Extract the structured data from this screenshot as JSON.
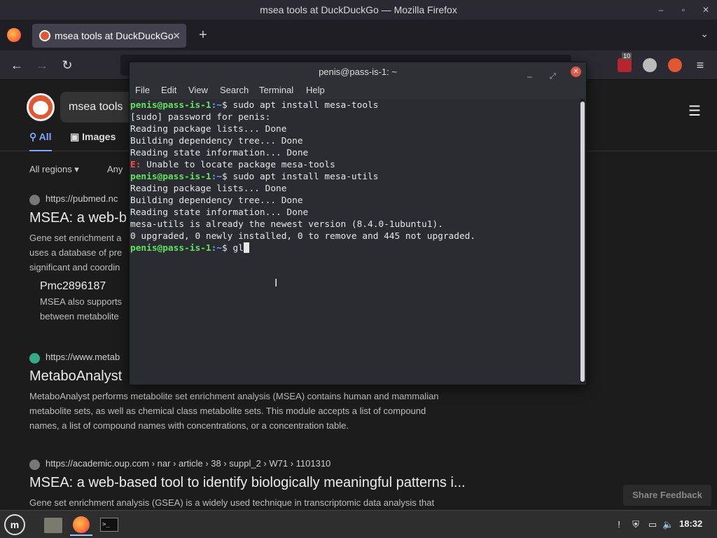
{
  "firefox": {
    "window_title": "msea tools at DuckDuckGo — Mozilla Firefox",
    "tab_title": "msea tools at DuckDuckGo",
    "tab_close": "✕",
    "new_tab": "+",
    "tablist": "⌄",
    "toolbar_badge": "10"
  },
  "ddg": {
    "search_query": "msea tools",
    "tabs": {
      "all": "All",
      "images": "Images"
    },
    "filters": {
      "region": "All regions ▾",
      "time": "Any"
    },
    "results": [
      {
        "url": "https://pubmed.nc",
        "title": "MSEA: a web-b",
        "snippet": [
          "Gene set enrichment a",
          "uses a database of pre",
          "significant and coordin"
        ],
        "sub": {
          "title": "Pmc2896187",
          "snippet": [
            "MSEA also supports",
            "between metabolite"
          ]
        }
      },
      {
        "url": "https://www.metab",
        "title": "MetaboAnalyst",
        "snippet": [
          "MetaboAnalyst performs metabolite set enrichment analysis (MSEA) contains human and mammalian",
          "metabolite sets, as well as chemical class metabolite sets. This module accepts a list of compound",
          "names, a list of compound names with concentrations, or a concentration table."
        ]
      },
      {
        "url": "https://academic.oup.com › nar › article › 38 › suppl_2 › W71 › 1101310",
        "title": "MSEA: a web-based tool to identify biologically meaningful patterns i...",
        "snippet": [
          "Gene set enrichment analysis (GSEA) is a widely used technique in transcriptomic data analysis that"
        ]
      }
    ],
    "share_feedback": "Share Feedback"
  },
  "terminal": {
    "title": "penis@pass-is-1: ~",
    "menu": [
      "File",
      "Edit",
      "View",
      "Search",
      "Terminal",
      "Help"
    ],
    "prompt_user": "penis@pass-is-1",
    "prompt_sep": ":",
    "prompt_path": "~",
    "prompt_dollar": "$ ",
    "cmd1": "sudo apt install mesa-tools",
    "out1": [
      "[sudo] password for penis:",
      "Reading package lists... Done",
      "Building dependency tree... Done",
      "Reading state information... Done"
    ],
    "err_prefix": "E:",
    "err_text": " Unable to locate package mesa-tools",
    "cmd2": "sudo apt install mesa-utils",
    "out2": [
      "Reading package lists... Done",
      "Building dependency tree... Done",
      "Reading state information... Done",
      "mesa-utils is already the newest version (8.4.0-1ubuntu1).",
      "0 upgraded, 0 newly installed, 0 to remove and 445 not upgraded."
    ],
    "current_input": "gl"
  },
  "taskbar": {
    "clock": "18:32"
  }
}
